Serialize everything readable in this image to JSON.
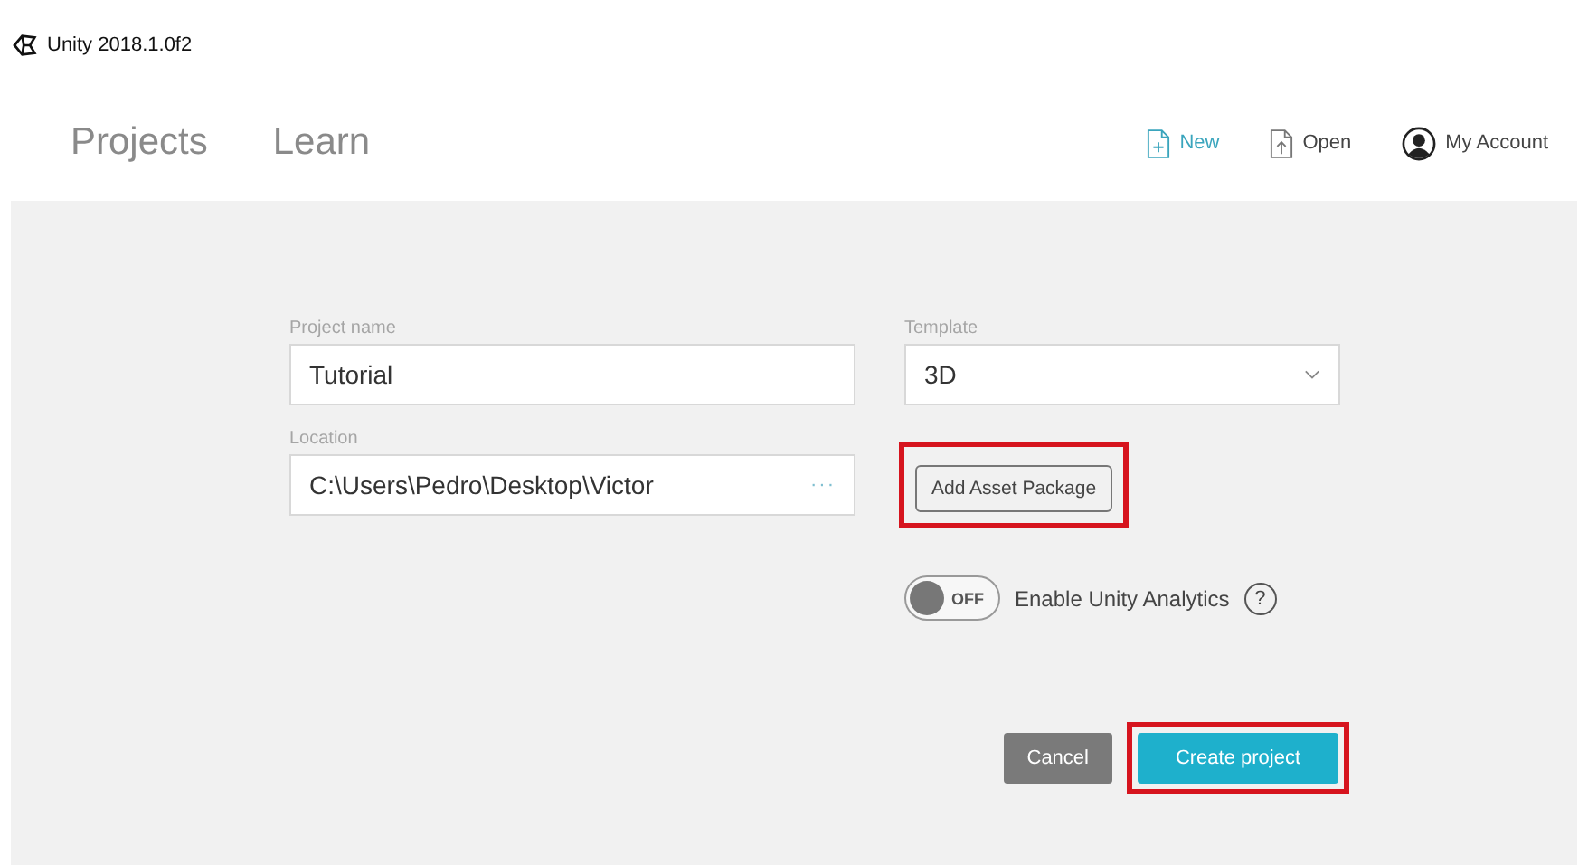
{
  "window": {
    "title": "Unity 2018.1.0f2"
  },
  "tabs": [
    {
      "label": "Projects"
    },
    {
      "label": "Learn"
    }
  ],
  "actions": [
    {
      "kind": "new",
      "label": "New",
      "selected": true
    },
    {
      "kind": "open",
      "label": "Open",
      "selected": false
    },
    {
      "kind": "account",
      "label": "My Account",
      "selected": false
    }
  ],
  "form": {
    "project_name": {
      "label": "Project name",
      "value": "Tutorial"
    },
    "location": {
      "label": "Location",
      "value": "C:\\Users\\Pedro\\Desktop\\Victor",
      "browse": "···"
    },
    "template": {
      "label": "Template",
      "value": "3D"
    },
    "add_asset_package": {
      "label": "Add Asset Package",
      "highlighted": true
    },
    "analytics": {
      "toggle_text": "OFF",
      "on": false,
      "label": "Enable Unity Analytics",
      "help": "?"
    }
  },
  "buttons": [
    {
      "kind": "cancel",
      "label": "Cancel",
      "highlighted": false
    },
    {
      "kind": "create",
      "label": "Create project",
      "highlighted": true
    }
  ]
}
